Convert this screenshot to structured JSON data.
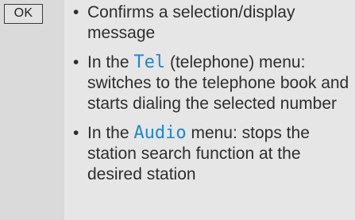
{
  "key": {
    "label": "OK"
  },
  "items": [
    {
      "text": "Confirms a selection/display message"
    },
    {
      "prefix": "In the ",
      "menu": "Tel",
      "suffix": " (telephone) menu: switches to the telephone book and starts dialing the selected number"
    },
    {
      "prefix": "In the ",
      "menu": "Audio",
      "suffix": " menu: stops the station search function at the desired station"
    }
  ],
  "bullet_char": "•",
  "colors": {
    "menu_name": "#1f86cc",
    "text": "#2e2e2e",
    "background": "#e6e6e6",
    "key_column": "#dadada"
  }
}
